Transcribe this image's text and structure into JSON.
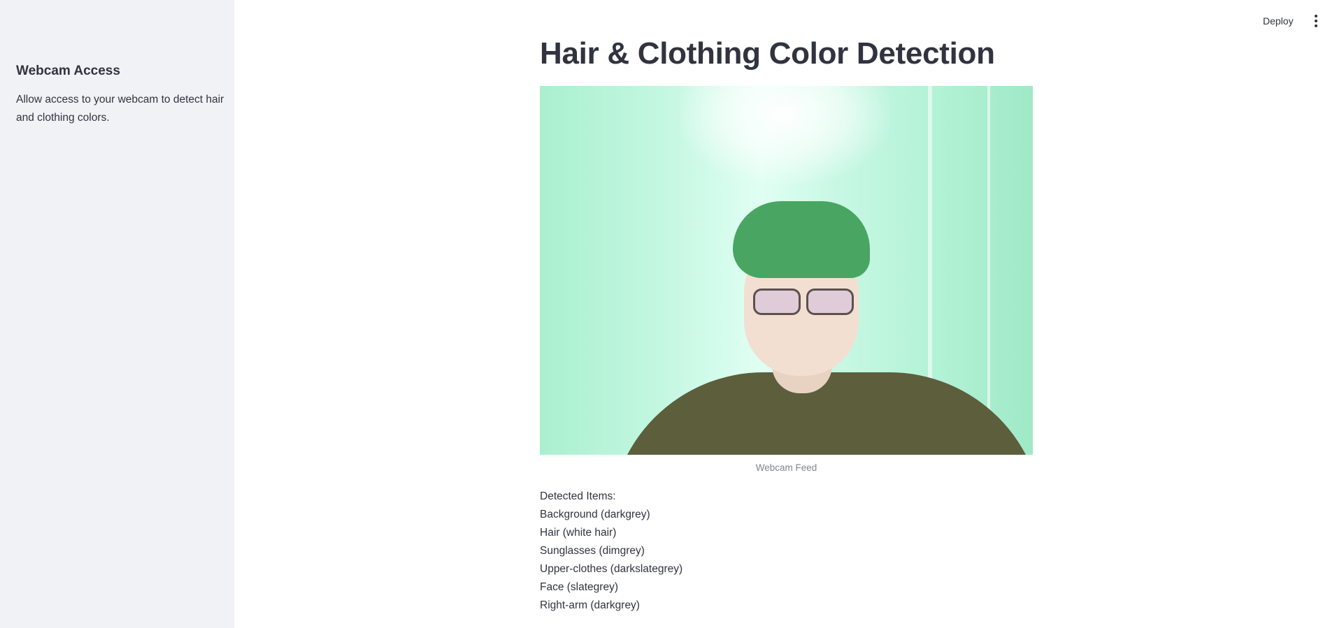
{
  "header": {
    "deploy_label": "Deploy",
    "menu_icon": "kebab-menu-icon"
  },
  "sidebar": {
    "title": "Webcam Access",
    "description": "Allow access to your webcam to detect hair and clothing colors."
  },
  "main": {
    "title": "Hair & Clothing Color Detection",
    "image_caption": "Webcam Feed",
    "results_heading": "Detected Items:",
    "detected_items": [
      "Background (darkgrey)",
      "Hair (white hair)",
      "Sunglasses (dimgrey)",
      "Upper-clothes (darkslategrey)",
      "Face (slategrey)",
      "Right-arm (darkgrey)"
    ]
  }
}
